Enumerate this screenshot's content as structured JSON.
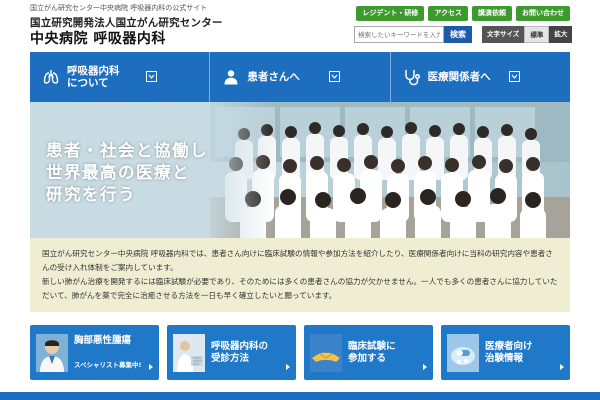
{
  "header": {
    "tagline": "国立がん研究センター中央病院 呼吸器内科の公式サイト",
    "org_name": "国立研究開発法人国立がん研究センター",
    "dept_name": "中央病院 呼吸器内科",
    "top_links": [
      "レジデント・研修",
      "アクセス",
      "講演依頼",
      "お問い合わせ"
    ],
    "search": {
      "placeholder": "検索したいキーワードを入力",
      "button": "検索"
    },
    "text_size": {
      "label": "文字サイズ",
      "standard": "標準",
      "large": "拡大"
    }
  },
  "nav": {
    "items": [
      {
        "label": "呼吸器内科\nについて",
        "icon": "lungs-icon"
      },
      {
        "label": "患者さんへ",
        "icon": "person-icon"
      },
      {
        "label": "医療関係者へ",
        "icon": "stethoscope-icon"
      }
    ]
  },
  "hero": {
    "line1": "患者・社会と協働し",
    "line2": "世界最高の医療と",
    "line3": "研究を行う"
  },
  "intro": {
    "p1": "国立がん研究センター中央病院 呼吸器内科では、患者さん向けに臨床試験の情報や参加方法を紹介したり、医療関係者向けに当科の研究内容や患者さんの受け入れ体制をご案内しています。",
    "p2": "新しい肺がん治療を開発するには臨床試験が必要であり、そのためには多くの患者さんの協力が欠かせません。一人でも多くの患者さんに協力していただいて、肺がんを薬で完全に治癒させる方法を一日も早く確立したいと願っています。"
  },
  "cards": [
    {
      "title": "胸部悪性腫瘍",
      "sub": "スペシャリスト募集中!",
      "icon": "doctor-photo"
    },
    {
      "title": "呼吸器内科の\n受診方法",
      "sub": "",
      "icon": "consultation-photo"
    },
    {
      "title": "臨床試験に\n参加する",
      "sub": "",
      "icon": "handshake-photo"
    },
    {
      "title": "医療者向け\n治験情報",
      "sub": "",
      "icon": "medicine-photo"
    }
  ],
  "colors": {
    "accent": "#1e6ec0",
    "green": "#3d9a2d",
    "intro_bg": "#f0eed2"
  }
}
